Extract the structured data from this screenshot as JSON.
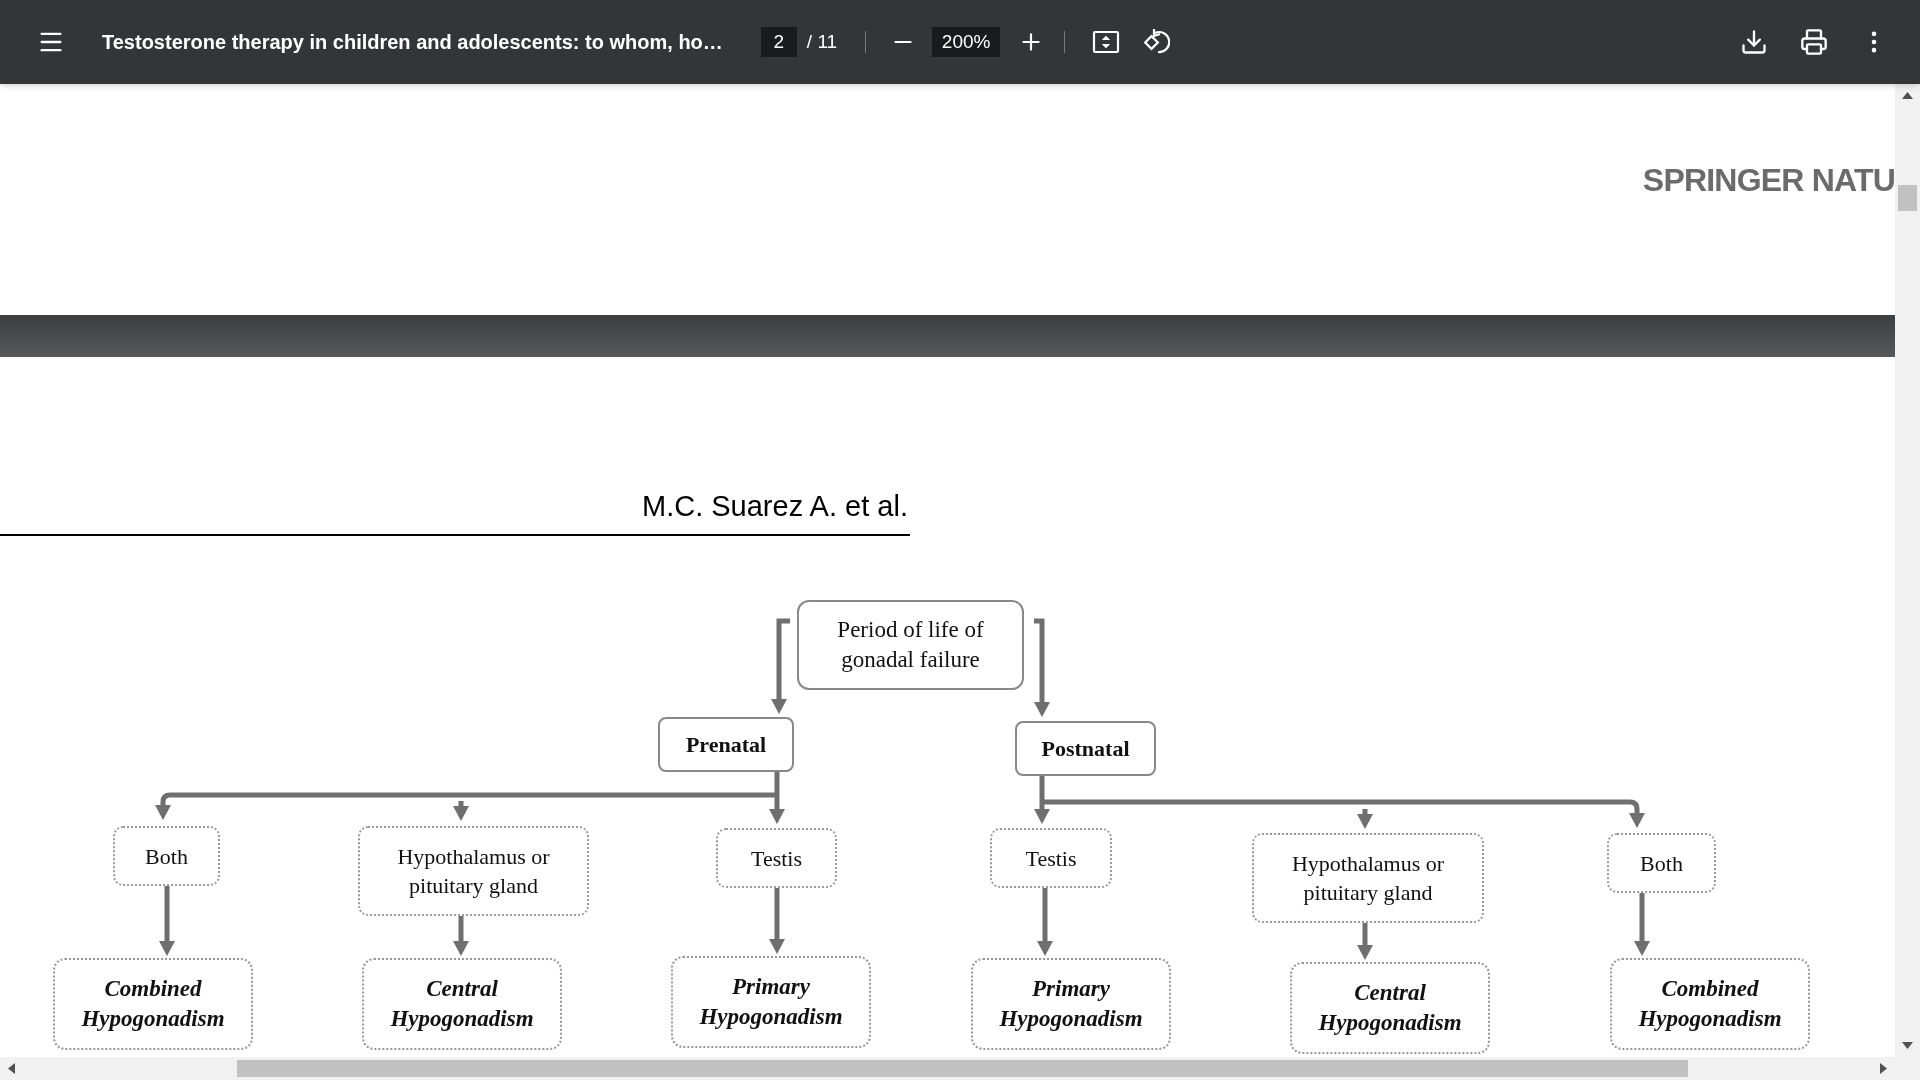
{
  "toolbar": {
    "title": "Testosterone therapy in children and adolescents: to whom, ho…",
    "page_number": "2",
    "page_count": "/ 11",
    "zoom": "200%"
  },
  "page_1": {
    "logo": "SPRINGER NATU"
  },
  "page_2": {
    "running_header": "M.C. Suarez A. et al.",
    "flowchart": {
      "root": "Period of life of gonadal failure",
      "branches": [
        {
          "label": "Prenatal",
          "children": [
            {
              "label": "Both",
              "result": "Combined Hypogonadism"
            },
            {
              "label": "Hypothalamus or pituitary gland",
              "result": "Central Hypogonadism"
            },
            {
              "label": "Testis",
              "result": "Primary Hypogonadism"
            }
          ]
        },
        {
          "label": "Postnatal",
          "children": [
            {
              "label": "Testis",
              "result": "Primary Hypogonadism"
            },
            {
              "label": "Hypothalamus or pituitary gland",
              "result": "Central Hypogonadism"
            },
            {
              "label": "Both",
              "result": "Combined Hypogonadism"
            }
          ]
        }
      ]
    }
  }
}
